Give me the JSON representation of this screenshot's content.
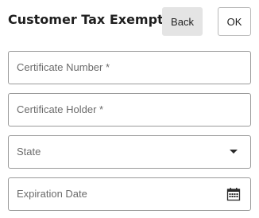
{
  "dialog": {
    "title": "Customer Tax Exempt",
    "back_label": "Back",
    "ok_label": "OK"
  },
  "fields": {
    "certificate_number": {
      "placeholder": "Certificate Number *"
    },
    "certificate_holder": {
      "placeholder": "Certificate Holder *"
    },
    "state": {
      "placeholder": "State",
      "icon": "chevron-down-icon"
    },
    "expiration_date": {
      "placeholder": "Expiration Date",
      "icon": "calendar-icon"
    }
  }
}
